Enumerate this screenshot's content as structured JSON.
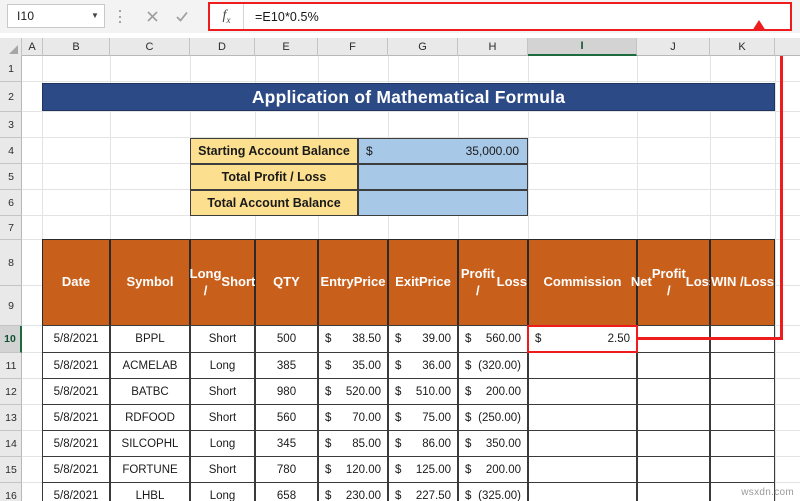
{
  "formula_bar": {
    "name_box_value": "I10",
    "name_box_dropdown_icon": "chevron-down-icon",
    "more_options_icon": "vertical-ellipsis-icon",
    "cancel_icon": "cancel-x-icon",
    "confirm_icon": "confirm-check-icon",
    "fx_label": "fx",
    "formula_value": "=E10*0.5%"
  },
  "columns": [
    "A",
    "B",
    "C",
    "D",
    "E",
    "F",
    "G",
    "H",
    "I",
    "J",
    "K"
  ],
  "selected_column": "I",
  "rows": [
    "1",
    "2",
    "3",
    "4",
    "5",
    "6",
    "7",
    "8",
    "9",
    "10",
    "11",
    "12",
    "13",
    "14",
    "15",
    "16"
  ],
  "selected_row": "10",
  "banner": {
    "title": "Application of Mathematical Formula"
  },
  "summary": {
    "rows": [
      {
        "label": "Starting Account Balance",
        "currency": "$",
        "amount": "35,000.00"
      },
      {
        "label": "Total Profit / Loss",
        "currency": "",
        "amount": ""
      },
      {
        "label": "Total Account Balance",
        "currency": "",
        "amount": ""
      }
    ]
  },
  "table": {
    "headers": [
      "Date",
      "Symbol",
      "Long /\nShort",
      "QTY",
      "Entry\nPrice",
      "Exit\nPrice",
      "Profit /\nLoss",
      "Commission",
      "Net\nProfit /\nLoss",
      "WIN /\nLoss"
    ],
    "rows": [
      {
        "date": "5/8/2021",
        "symbol": "BPPL",
        "side": "Short",
        "qty": "500",
        "entry_cur": "$",
        "entry": "38.50",
        "exit_cur": "$",
        "exit": "39.00",
        "pl_cur": "$",
        "pl": "560.00",
        "commission_cur": "$",
        "commission": "2.50",
        "net_cur": "",
        "net": "",
        "win_loss": ""
      },
      {
        "date": "5/8/2021",
        "symbol": "ACMELAB",
        "side": "Long",
        "qty": "385",
        "entry_cur": "$",
        "entry": "35.00",
        "exit_cur": "$",
        "exit": "36.00",
        "pl_cur": "$",
        "pl": "(320.00)",
        "commission_cur": "",
        "commission": "",
        "net_cur": "",
        "net": "",
        "win_loss": ""
      },
      {
        "date": "5/8/2021",
        "symbol": "BATBC",
        "side": "Short",
        "qty": "980",
        "entry_cur": "$",
        "entry": "520.00",
        "exit_cur": "$",
        "exit": "510.00",
        "pl_cur": "$",
        "pl": "200.00",
        "commission_cur": "",
        "commission": "",
        "net_cur": "",
        "net": "",
        "win_loss": ""
      },
      {
        "date": "5/8/2021",
        "symbol": "RDFOOD",
        "side": "Short",
        "qty": "560",
        "entry_cur": "$",
        "entry": "70.00",
        "exit_cur": "$",
        "exit": "75.00",
        "pl_cur": "$",
        "pl": "(250.00)",
        "commission_cur": "",
        "commission": "",
        "net_cur": "",
        "net": "",
        "win_loss": ""
      },
      {
        "date": "5/8/2021",
        "symbol": "SILCOPHL",
        "side": "Long",
        "qty": "345",
        "entry_cur": "$",
        "entry": "85.00",
        "exit_cur": "$",
        "exit": "86.00",
        "pl_cur": "$",
        "pl": "350.00",
        "commission_cur": "",
        "commission": "",
        "net_cur": "",
        "net": "",
        "win_loss": ""
      },
      {
        "date": "5/8/2021",
        "symbol": "FORTUNE",
        "side": "Short",
        "qty": "780",
        "entry_cur": "$",
        "entry": "120.00",
        "exit_cur": "$",
        "exit": "125.00",
        "pl_cur": "$",
        "pl": "200.00",
        "commission_cur": "",
        "commission": "",
        "net_cur": "",
        "net": "",
        "win_loss": ""
      },
      {
        "date": "5/8/2021",
        "symbol": "LHBL",
        "side": "Long",
        "qty": "658",
        "entry_cur": "$",
        "entry": "230.00",
        "exit_cur": "$",
        "exit": "227.50",
        "pl_cur": "$",
        "pl": "(325.00)",
        "commission_cur": "",
        "commission": "",
        "net_cur": "",
        "net": "",
        "win_loss": ""
      }
    ]
  },
  "annotations": {
    "highlight_color": "#ee1c1c",
    "formula_bar_highlighted": true,
    "active_cell_highlighted": "I10",
    "arrow": "callout-arrow-from-I10-to-formula-bar"
  },
  "watermark": "wsxdn.com"
}
